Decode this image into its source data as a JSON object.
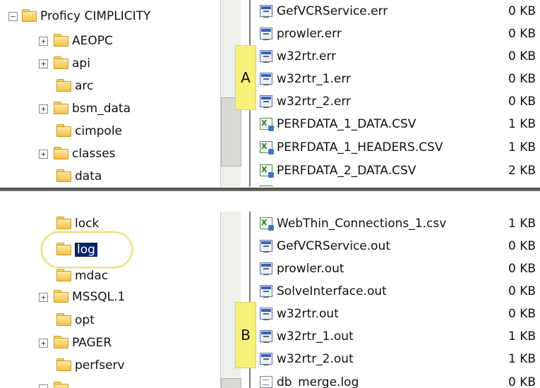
{
  "top_panel": {
    "tree": [
      {
        "label": "Proficy CIMPLICITY",
        "expander": "−"
      },
      {
        "label": "AEOPC",
        "expander": "+"
      },
      {
        "label": "api",
        "expander": "+"
      },
      {
        "label": "arc",
        "expander": ""
      },
      {
        "label": "bsm_data",
        "expander": "+"
      },
      {
        "label": "cimpole",
        "expander": ""
      },
      {
        "label": "classes",
        "expander": "+"
      },
      {
        "label": "data",
        "expander": ""
      }
    ],
    "marker": "A",
    "files": [
      {
        "name": "GefVCRService.err",
        "size": "0 KB",
        "icon": "log-file-icon"
      },
      {
        "name": "prowler.err",
        "size": "0 KB",
        "icon": "log-file-icon"
      },
      {
        "name": "w32rtr.err",
        "size": "0 KB",
        "icon": "log-file-icon"
      },
      {
        "name": "w32rtr_1.err",
        "size": "0 KB",
        "icon": "log-file-icon"
      },
      {
        "name": "w32rtr_2.err",
        "size": "0 KB",
        "icon": "log-file-icon"
      },
      {
        "name": "PERFDATA_1_DATA.CSV",
        "size": "1 KB",
        "icon": "csv-file-icon"
      },
      {
        "name": "PERFDATA_1_HEADERS.CSV",
        "size": "1 KB",
        "icon": "csv-file-icon"
      },
      {
        "name": "PERFDATA_2_DATA.CSV",
        "size": "2 KB",
        "icon": "csv-file-icon"
      }
    ]
  },
  "bottom_panel": {
    "tree": [
      {
        "label": "lock",
        "expander": ""
      },
      {
        "label": "log",
        "expander": "",
        "selected": true
      },
      {
        "label": "mdac",
        "expander": ""
      },
      {
        "label": "MSSQL.1",
        "expander": "+"
      },
      {
        "label": "opt",
        "expander": ""
      },
      {
        "label": "PAGER",
        "expander": "+"
      },
      {
        "label": "perfserv",
        "expander": ""
      }
    ],
    "marker": "B",
    "files": [
      {
        "name": "WebThin_Connections_1.csv",
        "size": "1 KB",
        "icon": "csv-file-icon"
      },
      {
        "name": "GefVCRService.out",
        "size": "0 KB",
        "icon": "log-file-icon"
      },
      {
        "name": "prowler.out",
        "size": "0 KB",
        "icon": "log-file-icon"
      },
      {
        "name": "SolveInterface.out",
        "size": "0 KB",
        "icon": "log-file-icon"
      },
      {
        "name": "w32rtr.out",
        "size": "0 KB",
        "icon": "log-file-icon"
      },
      {
        "name": "w32rtr_1.out",
        "size": "1 KB",
        "icon": "log-file-icon"
      },
      {
        "name": "w32rtr_2.out",
        "size": "1 KB",
        "icon": "log-file-icon"
      },
      {
        "name": "db_merge.log",
        "size": "0 KB",
        "icon": "text-file-icon"
      }
    ]
  },
  "colors": {
    "marker": "#f4f07a",
    "selection": "#0a246a",
    "highlight_ring": "#e8e07a"
  }
}
